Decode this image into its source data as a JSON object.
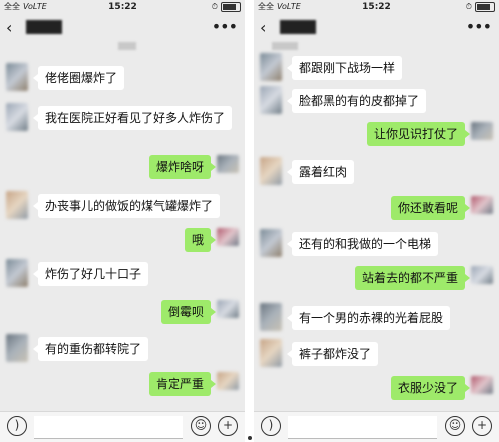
{
  "status_bar": {
    "signal_left": "全全",
    "network": "VoLTE",
    "time": "15:22"
  },
  "left_panel": {
    "messages": [
      {
        "side": "left",
        "text": "佬佬圈爆炸了"
      },
      {
        "side": "left",
        "text": "我在医院正好看见了好多人炸伤了"
      },
      {
        "side": "right",
        "text": "爆炸啥呀"
      },
      {
        "side": "left",
        "text": "办丧事儿的做饭的煤气罐爆炸了"
      },
      {
        "side": "right",
        "text": "哦"
      },
      {
        "side": "left",
        "text": "炸伤了好几十口子"
      },
      {
        "side": "right",
        "text": "倒霉呗"
      },
      {
        "side": "left",
        "text": "有的重伤都转院了"
      },
      {
        "side": "right",
        "text": "肯定严重"
      }
    ]
  },
  "right_panel": {
    "messages": [
      {
        "side": "left",
        "text": "都跟刚下战场一样"
      },
      {
        "side": "left",
        "text": "脸都黑的有的皮都掉了"
      },
      {
        "side": "right",
        "text": "让你见识打仗了"
      },
      {
        "side": "left",
        "text": "露着红肉"
      },
      {
        "side": "right",
        "text": "你还敢看呢"
      },
      {
        "side": "left",
        "text": "还有的和我做的一个电梯"
      },
      {
        "side": "right",
        "text": "站着去的都不严重"
      },
      {
        "side": "left",
        "text": "有一个男的赤裸的光着屁股"
      },
      {
        "side": "left",
        "text": "裤子都炸没了"
      },
      {
        "side": "right",
        "text": "衣服少没了"
      }
    ]
  },
  "icons": {
    "voice": "voice-icon",
    "emoji": "emoji-icon",
    "add": "add-icon",
    "back": "back-arrow-icon",
    "menu": "more-icon"
  },
  "colors": {
    "bubble_self": "#9eea6a",
    "bubble_other": "#ffffff",
    "background": "#ebebeb"
  }
}
